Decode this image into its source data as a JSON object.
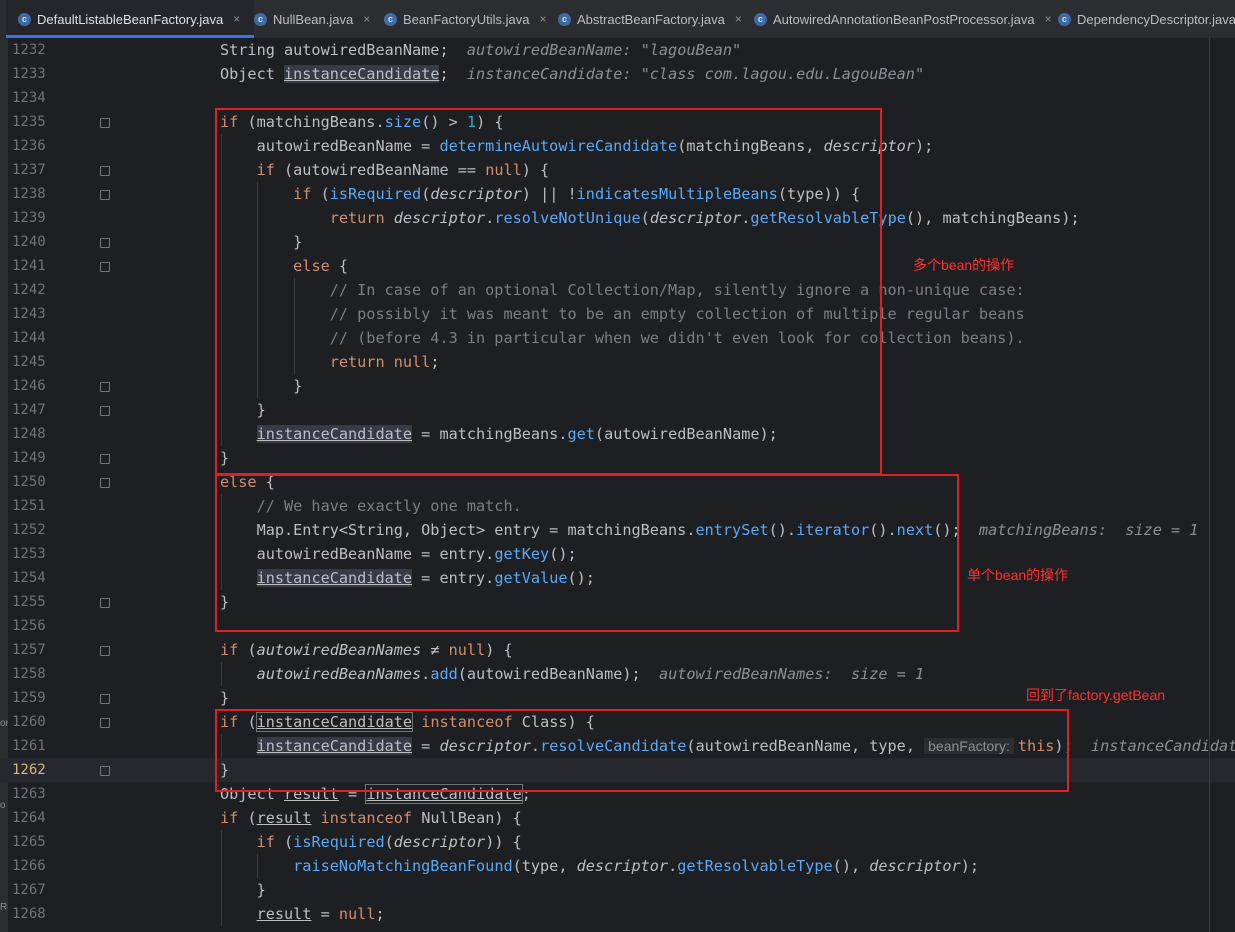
{
  "tabs": [
    {
      "label": "DefaultListableBeanFactory.java",
      "icon": "class-icon",
      "active": true,
      "close": "×"
    },
    {
      "label": "NullBean.java",
      "icon": "class-icon",
      "active": false,
      "close": "×"
    },
    {
      "label": "BeanFactoryUtils.java",
      "icon": "class-icon",
      "active": false,
      "close": "×"
    },
    {
      "label": "AbstractBeanFactory.java",
      "icon": "class-icon",
      "active": false,
      "close": "×"
    },
    {
      "label": "AutowiredAnnotationBeanPostProcessor.java",
      "icon": "class-icon",
      "active": false,
      "close": "×"
    },
    {
      "label": "DependencyDescriptor.java",
      "icon": "class-icon",
      "active": false,
      "close": ""
    }
  ],
  "left_strip": [
    "or",
    "o",
    "Re"
  ],
  "annotations": {
    "multi": "多个bean的操作",
    "single": "单个bean的操作",
    "back": "回到了factory.getBean"
  },
  "current_line": 1262,
  "colors": {
    "annotation": "#ff3030",
    "keyword": "#cf8e6d",
    "method": "#56a8f5",
    "number": "#2aacb8"
  },
  "lines": [
    {
      "n": "1232",
      "t": [
        [
          "String autowiredBeanName;  ",
          ""
        ],
        [
          "autowiredBeanName: \"lagouBean\"",
          "hint"
        ]
      ]
    },
    {
      "n": "1233",
      "t": [
        [
          "Object ",
          ""
        ],
        [
          "instanceCandidate",
          "h"
        ],
        [
          ";  ",
          ""
        ],
        [
          "instanceCandidate: \"class com.lagou.edu.LagouBean\"",
          "hint"
        ]
      ]
    },
    {
      "n": "1234",
      "t": []
    },
    {
      "n": "1235",
      "t": [
        [
          "if",
          "k"
        ],
        [
          " (matchingBeans.",
          ""
        ],
        [
          "size",
          "m"
        ],
        [
          "() > ",
          ""
        ],
        [
          "1",
          "n"
        ],
        [
          ") {",
          ""
        ]
      ]
    },
    {
      "n": "1236",
      "t": [
        [
          "    autowiredBeanName = ",
          ""
        ],
        [
          "determineAutowireCandidate",
          "m"
        ],
        [
          "(matchingBeans, ",
          ""
        ],
        [
          "descriptor",
          "p"
        ],
        [
          ");",
          ""
        ]
      ]
    },
    {
      "n": "1237",
      "t": [
        [
          "    ",
          ""
        ],
        [
          "if",
          "k"
        ],
        [
          " (autowiredBeanName == ",
          ""
        ],
        [
          "null",
          "k"
        ],
        [
          ") {",
          ""
        ]
      ]
    },
    {
      "n": "1238",
      "t": [
        [
          "        ",
          ""
        ],
        [
          "if",
          "k"
        ],
        [
          " (",
          ""
        ],
        [
          "isRequired",
          "m"
        ],
        [
          "(",
          ""
        ],
        [
          "descriptor",
          "p"
        ],
        [
          ") || !",
          ""
        ],
        [
          "indicatesMultipleBeans",
          "m"
        ],
        [
          "(type)) {",
          ""
        ]
      ]
    },
    {
      "n": "1239",
      "t": [
        [
          "            ",
          ""
        ],
        [
          "return",
          "k"
        ],
        [
          " ",
          ""
        ],
        [
          "descriptor",
          "p"
        ],
        [
          ".",
          ""
        ],
        [
          "resolveNotUnique",
          "m"
        ],
        [
          "(",
          ""
        ],
        [
          "descriptor",
          "p"
        ],
        [
          ".",
          ""
        ],
        [
          "getResolvableType",
          "m"
        ],
        [
          "(), matchingBeans);",
          ""
        ]
      ]
    },
    {
      "n": "1240",
      "t": [
        [
          "        }",
          ""
        ]
      ]
    },
    {
      "n": "1241",
      "t": [
        [
          "        ",
          ""
        ],
        [
          "else",
          "k"
        ],
        [
          " {",
          ""
        ]
      ]
    },
    {
      "n": "1242",
      "t": [
        [
          "            // In case of an optional Collection/Map, silently ignore a non-unique case:",
          "c"
        ]
      ]
    },
    {
      "n": "1243",
      "t": [
        [
          "            // possibly it was meant to be an empty collection of multiple regular beans",
          "c"
        ]
      ]
    },
    {
      "n": "1244",
      "t": [
        [
          "            // (before 4.3 in particular when we didn't even look for collection beans).",
          "c"
        ]
      ]
    },
    {
      "n": "1245",
      "t": [
        [
          "            ",
          ""
        ],
        [
          "return",
          "k"
        ],
        [
          " ",
          ""
        ],
        [
          "null",
          "k"
        ],
        [
          ";",
          ""
        ]
      ]
    },
    {
      "n": "1246",
      "t": [
        [
          "        }",
          ""
        ]
      ]
    },
    {
      "n": "1247",
      "t": [
        [
          "    }",
          ""
        ]
      ]
    },
    {
      "n": "1248",
      "t": [
        [
          "    ",
          ""
        ],
        [
          "instanceCandidate",
          "h"
        ],
        [
          " = matchingBeans.",
          ""
        ],
        [
          "get",
          "m"
        ],
        [
          "(autowiredBeanName);",
          ""
        ]
      ]
    },
    {
      "n": "1249",
      "t": [
        [
          "}",
          ""
        ]
      ]
    },
    {
      "n": "1250",
      "t": [
        [
          "else",
          "k"
        ],
        [
          " {",
          ""
        ]
      ]
    },
    {
      "n": "1251",
      "t": [
        [
          "    // We have exactly one match.",
          "c"
        ]
      ]
    },
    {
      "n": "1252",
      "t": [
        [
          "    Map.Entry<String, Object> entry = matchingBeans.",
          ""
        ],
        [
          "entrySet",
          "m"
        ],
        [
          "().",
          ""
        ],
        [
          "iterator",
          "m"
        ],
        [
          "().",
          ""
        ],
        [
          "next",
          "m"
        ],
        [
          "();  ",
          ""
        ],
        [
          "matchingBeans:  size = 1",
          "hint"
        ]
      ]
    },
    {
      "n": "1253",
      "t": [
        [
          "    autowiredBeanName = entry.",
          ""
        ],
        [
          "getKey",
          "m"
        ],
        [
          "();",
          ""
        ]
      ]
    },
    {
      "n": "1254",
      "t": [
        [
          "    ",
          ""
        ],
        [
          "instanceCandidate",
          "h"
        ],
        [
          " = entry.",
          ""
        ],
        [
          "getValue",
          "m"
        ],
        [
          "();",
          ""
        ]
      ]
    },
    {
      "n": "1255",
      "t": [
        [
          "}",
          ""
        ]
      ]
    },
    {
      "n": "1256",
      "t": []
    },
    {
      "n": "1257",
      "t": [
        [
          "if",
          "k"
        ],
        [
          " (",
          ""
        ],
        [
          "autowiredBeanNames",
          "p"
        ],
        [
          " ≠ ",
          ""
        ],
        [
          "null",
          "k"
        ],
        [
          ") {",
          ""
        ]
      ]
    },
    {
      "n": "1258",
      "t": [
        [
          "    ",
          ""
        ],
        [
          "autowiredBeanNames",
          "p"
        ],
        [
          ".",
          ""
        ],
        [
          "add",
          "m"
        ],
        [
          "(autowiredBeanName);  ",
          ""
        ],
        [
          "autowiredBeanNames:  size = 1",
          "hint"
        ]
      ]
    },
    {
      "n": "1259",
      "t": [
        [
          "}",
          ""
        ]
      ]
    },
    {
      "n": "1260",
      "t": [
        [
          "if",
          "k"
        ],
        [
          " (",
          ""
        ],
        [
          "instanceCandidate",
          "h2"
        ],
        [
          " ",
          ""
        ],
        [
          "instanceof",
          "k"
        ],
        [
          " Class) {",
          ""
        ]
      ]
    },
    {
      "n": "1261",
      "t": [
        [
          "    ",
          ""
        ],
        [
          "instanceCandidate",
          "h"
        ],
        [
          " = ",
          ""
        ],
        [
          "descriptor",
          "p"
        ],
        [
          ".",
          ""
        ],
        [
          "resolveCandidate",
          "m"
        ],
        [
          "(autowiredBeanName, type, ",
          ""
        ],
        [
          "beanFactory:",
          "inlay"
        ],
        [
          "this",
          "k"
        ],
        [
          ");  ",
          ""
        ],
        [
          "instanceCandidate",
          "hint"
        ]
      ]
    },
    {
      "n": "1262",
      "t": [
        [
          "}",
          ""
        ]
      ]
    },
    {
      "n": "1263",
      "t": [
        [
          "Object ",
          ""
        ],
        [
          "result",
          "u"
        ],
        [
          " = ",
          ""
        ],
        [
          "instanceCandidate",
          "h2"
        ],
        [
          ";",
          ""
        ]
      ]
    },
    {
      "n": "1264",
      "t": [
        [
          "if",
          "k"
        ],
        [
          " (",
          ""
        ],
        [
          "result",
          "u"
        ],
        [
          " ",
          ""
        ],
        [
          "instanceof",
          "k"
        ],
        [
          " NullBean) {",
          ""
        ]
      ]
    },
    {
      "n": "1265",
      "t": [
        [
          "    ",
          ""
        ],
        [
          "if",
          "k"
        ],
        [
          " (",
          ""
        ],
        [
          "isRequired",
          "m"
        ],
        [
          "(",
          ""
        ],
        [
          "descriptor",
          "p"
        ],
        [
          ")) {",
          ""
        ]
      ]
    },
    {
      "n": "1266",
      "t": [
        [
          "        ",
          ""
        ],
        [
          "raiseNoMatchingBeanFound",
          "m"
        ],
        [
          "(type, ",
          ""
        ],
        [
          "descriptor",
          "p"
        ],
        [
          ".",
          ""
        ],
        [
          "getResolvableType",
          "m"
        ],
        [
          "(), ",
          ""
        ],
        [
          "descriptor",
          "p"
        ],
        [
          ");",
          ""
        ]
      ]
    },
    {
      "n": "1267",
      "t": [
        [
          "    }",
          ""
        ]
      ]
    },
    {
      "n": "1268",
      "t": [
        [
          "    ",
          ""
        ],
        [
          "result",
          "u"
        ],
        [
          " = ",
          ""
        ],
        [
          "null",
          "k"
        ],
        [
          ";",
          ""
        ]
      ]
    }
  ]
}
